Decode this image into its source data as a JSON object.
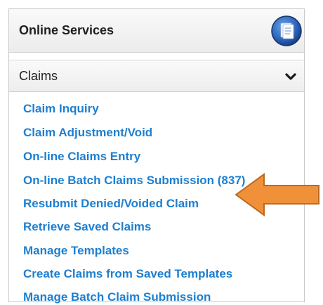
{
  "panel": {
    "title": "Online Services",
    "icon": "document-icon"
  },
  "section": {
    "title": "Claims",
    "expanded": true,
    "icon": "chevron-down-icon"
  },
  "links": [
    "Claim Inquiry",
    "Claim Adjustment/Void",
    "On-line Claims Entry",
    "On-line Batch Claims Submission (837)",
    "Resubmit Denied/Voided Claim",
    "Retrieve Saved Claims",
    "Manage Templates",
    "Create Claims from Saved Templates",
    "Manage Batch Claim Submission"
  ],
  "annotation": {
    "type": "arrow",
    "points_to": "Resubmit Denied/Voided Claim",
    "color": "#f0913a",
    "stroke": "#b96a22"
  },
  "colors": {
    "link": "#1e7fd0",
    "header_text": "#1f1f1f",
    "border": "#c9c9c9"
  }
}
